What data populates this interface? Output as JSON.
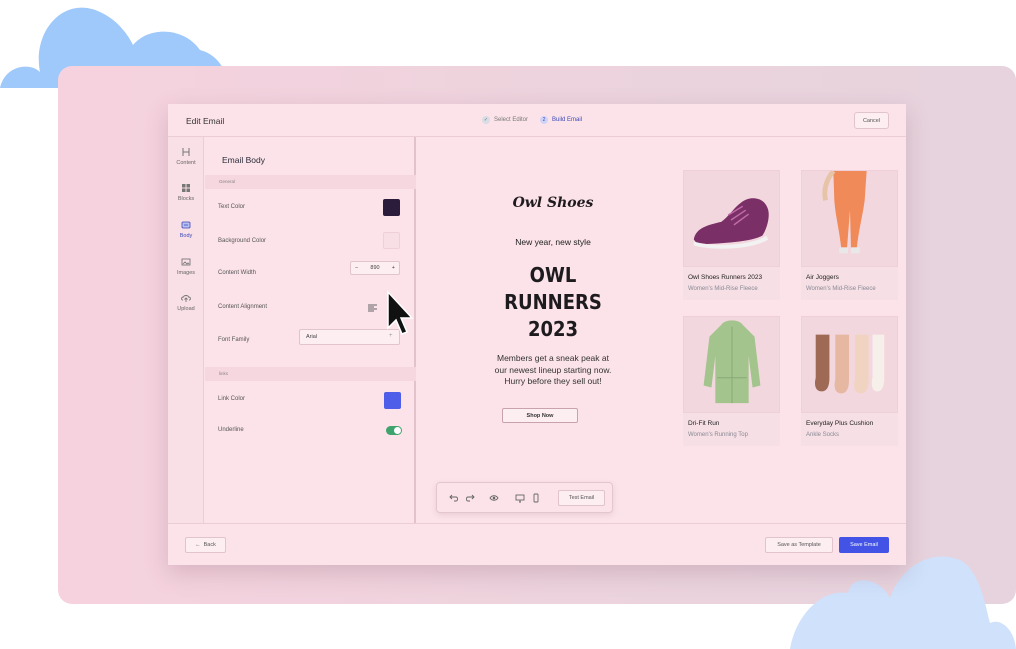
{
  "colors": {
    "accent": "#4353e6",
    "text_color_swatch": "#2a1c3a",
    "background_color_swatch": "#f7dfe5",
    "link_color_swatch": "#4f5ee8",
    "toggle_on": "#3fa36e"
  },
  "header": {
    "title": "Edit Email",
    "steps": [
      {
        "label": "Select Editor",
        "marker": "✓"
      },
      {
        "label": "Build Email",
        "marker": "2"
      }
    ],
    "cancel_label": "Cancel"
  },
  "rail": {
    "items": [
      {
        "label": "Content",
        "icon": "heading-icon"
      },
      {
        "label": "Blocks",
        "icon": "blocks-icon"
      },
      {
        "label": "Body",
        "icon": "body-icon"
      },
      {
        "label": "Images",
        "icon": "image-icon"
      },
      {
        "label": "Upload",
        "icon": "upload-icon"
      }
    ]
  },
  "props": {
    "heading": "Email Body",
    "general_section": "General",
    "links_section": "links",
    "text_color_label": "Text Color",
    "background_color_label": "Background Color",
    "content_width_label": "Content Width",
    "content_width_value": "890",
    "content_alignment_label": "Content Alignment",
    "font_family_label": "Font Family",
    "font_family_value": "Arial",
    "link_color_label": "Link Color",
    "underline_label": "Underline",
    "underline_on": true
  },
  "email": {
    "brand": "Owl Shoes",
    "tagline": "New year, new style",
    "headline_lines": [
      "OWL",
      "RUNNERS",
      "2023"
    ],
    "body_lines": [
      "Members get a sneak peak at",
      "our newest lineup starting now.",
      "Hurry before they sell out!"
    ],
    "cta": "Shop Now"
  },
  "products": [
    {
      "name": "Owl Shoes Runners 2023",
      "desc": "Women's Mid-Rise Fleece"
    },
    {
      "name": "Air Joggers",
      "desc": "Women's Mid-Rise Fleece"
    },
    {
      "name": "Dri-Fit Run",
      "desc": "Women's Running Top"
    },
    {
      "name": "Everyday Plus Cushion",
      "desc": "Ankle Socks"
    }
  ],
  "toolbar": {
    "test_label": "Test Email"
  },
  "footer": {
    "back_label": "Back",
    "template_label": "Save as Template",
    "save_label": "Save Email"
  }
}
